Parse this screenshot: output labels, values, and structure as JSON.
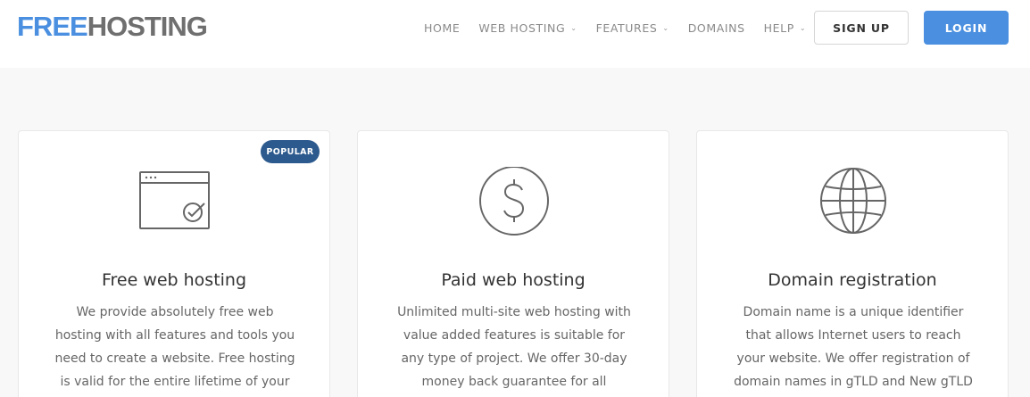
{
  "header": {
    "logo_free": "FREE",
    "logo_hosting": "HOSTING",
    "nav": [
      {
        "label": "HOME"
      },
      {
        "label": "WEB HOSTING"
      },
      {
        "label": "FEATURES"
      },
      {
        "label": "DOMAINS"
      },
      {
        "label": "HELP"
      }
    ],
    "signup_label": "SIGN UP",
    "login_label": "LOGIN"
  },
  "cards": [
    {
      "badge": "POPULAR",
      "icon": "browser-check-icon",
      "title": "Free web hosting",
      "text": "We provide absolutely free web hosting with all features and tools you need to create a website. Free hosting is valid for the entire lifetime of your domain."
    },
    {
      "icon": "dollar-icon",
      "title": "Paid web hosting",
      "text": "Unlimited multi-site web hosting with value added features is suitable for any type of project. We offer 30-day money back guarantee for all purchases."
    },
    {
      "icon": "globe-icon",
      "title": "Domain registration",
      "text": "Domain name is a unique identifier that allows Internet users to reach your website. We offer registration of domain names in gTLD and New gTLD zones."
    }
  ],
  "colors": {
    "brand_blue": "#4a8fe0",
    "badge_blue": "#2d5a8e",
    "logo_gray": "#6f6f6f",
    "page_bg": "#f8f8f8"
  }
}
